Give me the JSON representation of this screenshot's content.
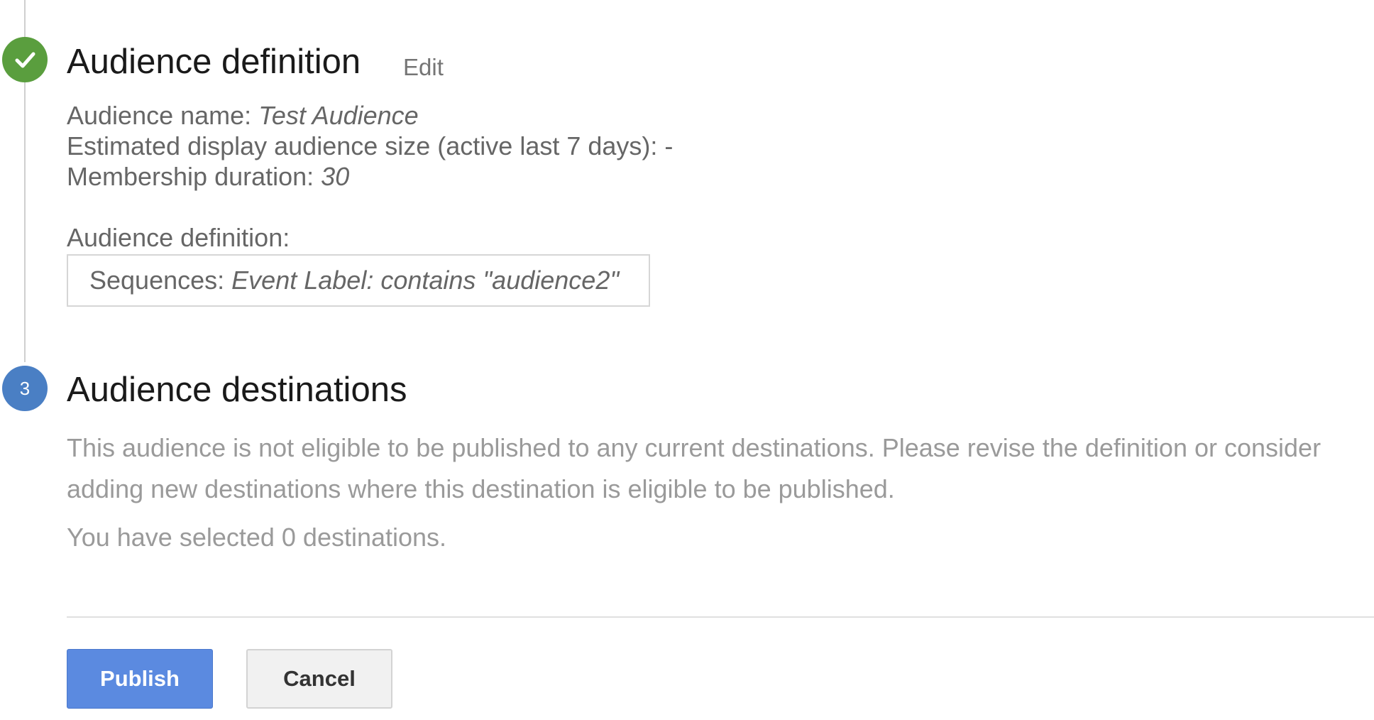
{
  "steps": {
    "definition": {
      "title": "Audience definition",
      "edit_label": "Edit",
      "name_label": "Audience name: ",
      "name_value": "Test Audience",
      "size_label": "Estimated display audience size (active last 7 days): -",
      "duration_label": "Membership duration: ",
      "duration_value": "30",
      "definition_label": "Audience definition:",
      "sequences_label": "Sequences: ",
      "sequences_value": "Event Label: contains \"audience2\""
    },
    "destinations": {
      "number": "3",
      "title": "Audience destinations",
      "description": "This audience is not eligible to be published to any current destinations. Please revise the definition or consider adding new destinations where this destination is eligible to be published.",
      "selected_text": "You have selected 0 destinations."
    }
  },
  "actions": {
    "publish_label": "Publish",
    "cancel_label": "Cancel"
  },
  "colors": {
    "complete": "#5a9e3e",
    "current_step": "#4a7fc4",
    "primary_button": "#5b8ae0"
  },
  "icons": {
    "complete_step": "check-circle-icon"
  }
}
